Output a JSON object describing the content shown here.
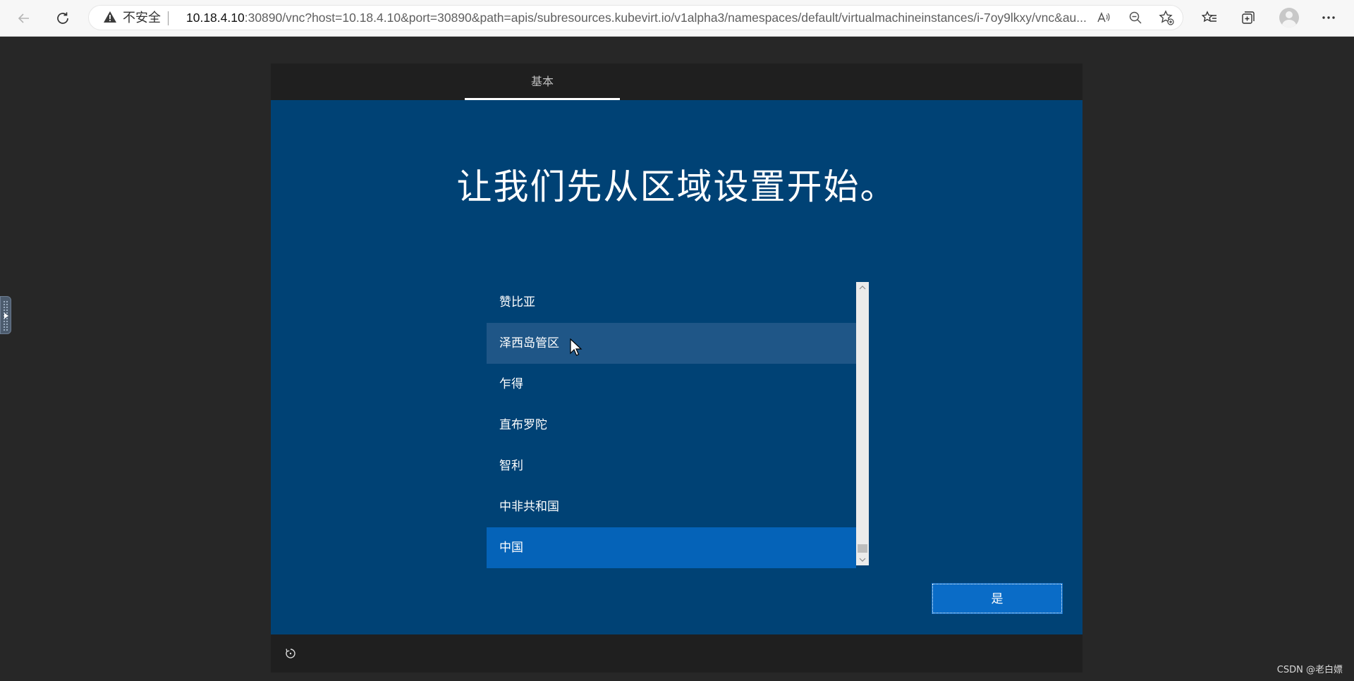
{
  "browser": {
    "security_label": "不安全",
    "url_host": "10.18.4.10",
    "url_rest": ":30890/vnc?host=10.18.4.10&port=30890&path=apis/subresources.kubevirt.io/v1alpha3/namespaces/default/virtualmachineinstances/i-7oy9lkxy/vnc&au..."
  },
  "oobe": {
    "tab_label": "基本",
    "title": "让我们先从区域设置开始。",
    "regions": [
      "赞比亚",
      "泽西岛管区",
      "乍得",
      "直布罗陀",
      "智利",
      "中非共和国",
      "中国"
    ],
    "hovered_region": "泽西岛管区",
    "selected_region": "中国",
    "confirm_label": "是"
  },
  "watermark": "CSDN @老白嫖",
  "colors": {
    "oobe_bg": "#004275",
    "selected": "#0563b8",
    "hover": "#1f5687",
    "button": "#0a6cc7"
  },
  "icons": [
    "back-arrow-icon",
    "refresh-icon",
    "warning-icon",
    "read-aloud-icon",
    "zoom-out-icon",
    "add-favorite-icon",
    "favorites-icon",
    "collections-icon",
    "profile-icon",
    "more-icon",
    "power-icon"
  ]
}
